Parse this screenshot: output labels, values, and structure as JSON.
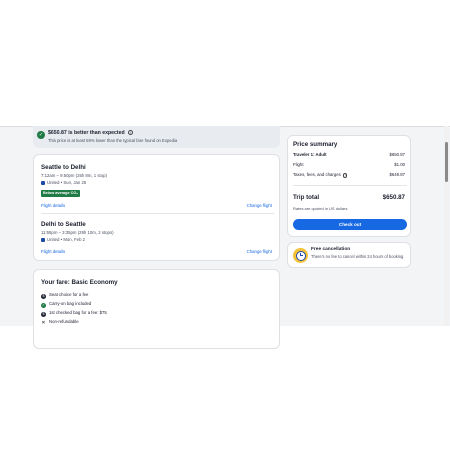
{
  "notice": {
    "title": "$650.87 is better than expected",
    "subtitle": "This price is at least 59% lower than the typical fare found on Expedia",
    "badge_icon": "price-tag-icon",
    "info_icon": "info-icon"
  },
  "flights": [
    {
      "route": "Seattle to Delhi",
      "times": "7:12am – 9:50pm (25h 8m, 1 stop)",
      "airline": "United • Sun, Jan 25",
      "badge": "Below average CO₂",
      "details_link": "Flight details",
      "change_link": "Change flight"
    },
    {
      "route": "Delhi to Seattle",
      "times": "11:55pm – 3:35pm (29h 10m, 2 stops)",
      "airline": "United • Mon, Feb 2",
      "details_link": "Flight details",
      "change_link": "Change flight"
    }
  ],
  "fare": {
    "title": "Your fare: Basic Economy",
    "items": [
      {
        "icon": "dollar-icon",
        "text": "Seat choice for a fee"
      },
      {
        "icon": "check-icon",
        "text": "Carry-on bag included"
      },
      {
        "icon": "dollar-icon",
        "text": "1st checked bag for a fee: $75"
      },
      {
        "icon": "close-icon",
        "text": "Non-refundable"
      }
    ]
  },
  "summary": {
    "title": "Price summary",
    "traveler_label": "Traveler 1: Adult",
    "traveler_value": "$650.87",
    "flight_label": "Flight",
    "flight_value": "$1.00",
    "taxes_label": "Taxes, fees, and charges",
    "taxes_value": "$649.87",
    "trip_total_label": "Trip total",
    "trip_total_value": "$650.87",
    "rates_note": "Rates are quoted in US dollars",
    "checkout_label": "Check out"
  },
  "cancellation": {
    "title": "Free cancellation",
    "text": "There's no fee to cancel within 24 hours of booking.",
    "icon": "clock-icon"
  },
  "colors": {
    "accent": "#1668e3",
    "green": "#1f7a45",
    "page_bg": "#f3f4f6"
  }
}
